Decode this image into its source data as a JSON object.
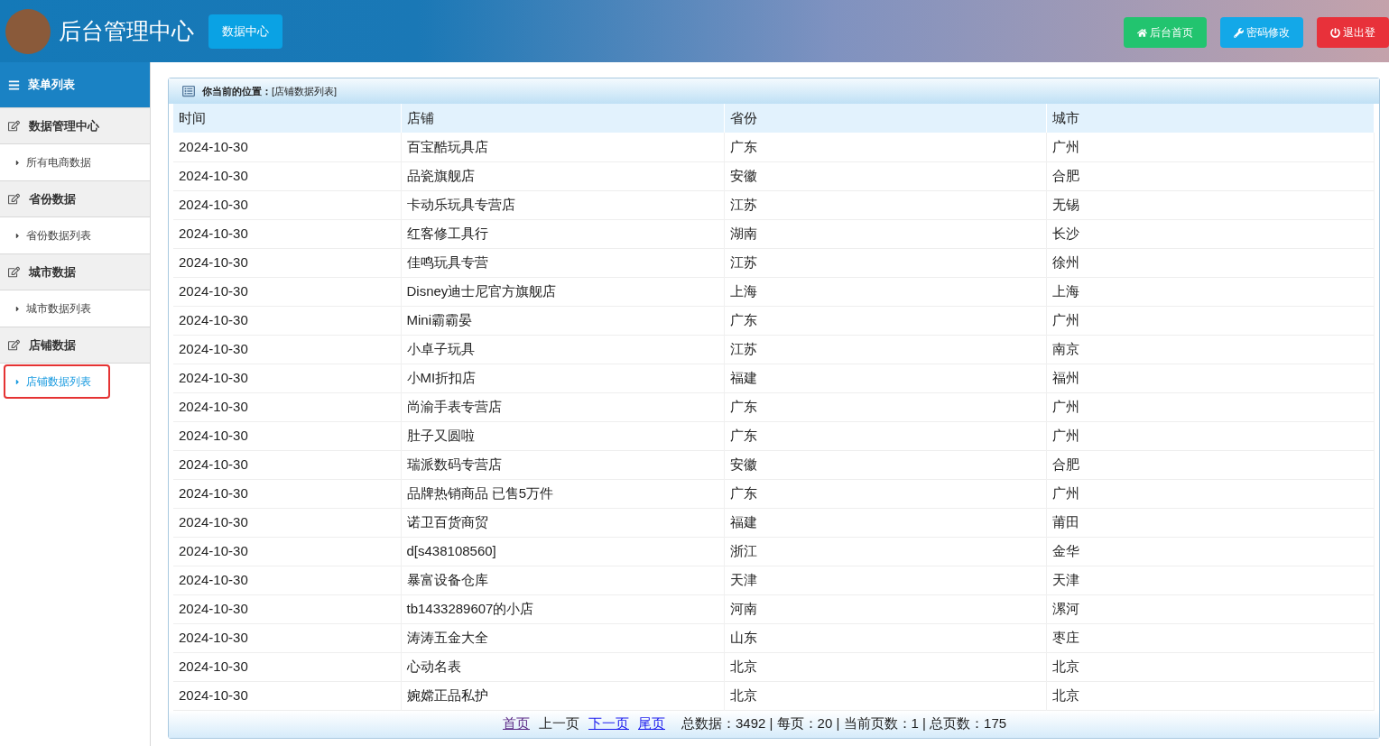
{
  "header": {
    "title": "后台管理中心",
    "tab": "数据中心",
    "buttons": [
      {
        "kind": "home",
        "label": "后台首页"
      },
      {
        "kind": "password",
        "label": "密码修改"
      },
      {
        "kind": "logout",
        "label": "退出登"
      }
    ]
  },
  "sidebar": {
    "title": "菜单列表",
    "groups": [
      {
        "label": "数据管理中心",
        "items": [
          {
            "label": "所有电商数据",
            "selected": false
          }
        ]
      },
      {
        "label": "省份数据",
        "items": [
          {
            "label": "省份数据列表",
            "selected": false
          }
        ]
      },
      {
        "label": "城市数据",
        "items": [
          {
            "label": "城市数据列表",
            "selected": false
          }
        ]
      },
      {
        "label": "店铺数据",
        "items": [
          {
            "label": "店铺数据列表",
            "selected": true
          }
        ]
      }
    ]
  },
  "breadcrumb": {
    "label": "你当前的位置：",
    "path": "[店铺数据列表]"
  },
  "table": {
    "columns": [
      "时间",
      "店铺",
      "省份",
      "城市"
    ],
    "rows": [
      [
        "2024-10-30",
        "百宝酷玩具店",
        "广东",
        "广州"
      ],
      [
        "2024-10-30",
        "品瓷旗舰店",
        "安徽",
        "合肥"
      ],
      [
        "2024-10-30",
        "卡动乐玩具专营店",
        "江苏",
        "无锡"
      ],
      [
        "2024-10-30",
        "红客修工具行",
        "湖南",
        "长沙"
      ],
      [
        "2024-10-30",
        "佳鸣玩具专营",
        "江苏",
        "徐州"
      ],
      [
        "2024-10-30",
        "Disney迪士尼官方旗舰店",
        "上海",
        "上海"
      ],
      [
        "2024-10-30",
        "Mini霸霸晏",
        "广东",
        "广州"
      ],
      [
        "2024-10-30",
        "小卓子玩具",
        "江苏",
        "南京"
      ],
      [
        "2024-10-30",
        "小MI折扣店",
        "福建",
        "福州"
      ],
      [
        "2024-10-30",
        "尚渝手表专营店",
        "广东",
        "广州"
      ],
      [
        "2024-10-30",
        "肚子又圆啦",
        "广东",
        "广州"
      ],
      [
        "2024-10-30",
        "瑞派数码专营店",
        "安徽",
        "合肥"
      ],
      [
        "2024-10-30",
        "品牌热销商品 已售5万件",
        "广东",
        "广州"
      ],
      [
        "2024-10-30",
        "诺卫百货商贸",
        "福建",
        "莆田"
      ],
      [
        "2024-10-30",
        "d[s438108560]",
        "浙江",
        "金华"
      ],
      [
        "2024-10-30",
        "暴富设备仓库",
        "天津",
        "天津"
      ],
      [
        "2024-10-30",
        "tb1433289607的小店",
        "河南",
        "漯河"
      ],
      [
        "2024-10-30",
        "涛涛五金大全",
        "山东",
        "枣庄"
      ],
      [
        "2024-10-30",
        "心动名表",
        "北京",
        "北京"
      ],
      [
        "2024-10-30",
        "婉嫦正品私护",
        "北京",
        "北京"
      ]
    ]
  },
  "pagination": {
    "links": [
      {
        "label": "首页",
        "kind": "visited"
      },
      {
        "label": "上一页",
        "kind": "plain"
      },
      {
        "label": "下一页",
        "kind": "link"
      },
      {
        "label": "尾页",
        "kind": "link"
      }
    ],
    "summary": "总数据：3492 | 每页：20 | 当前页数：1 | 总页数：175"
  }
}
